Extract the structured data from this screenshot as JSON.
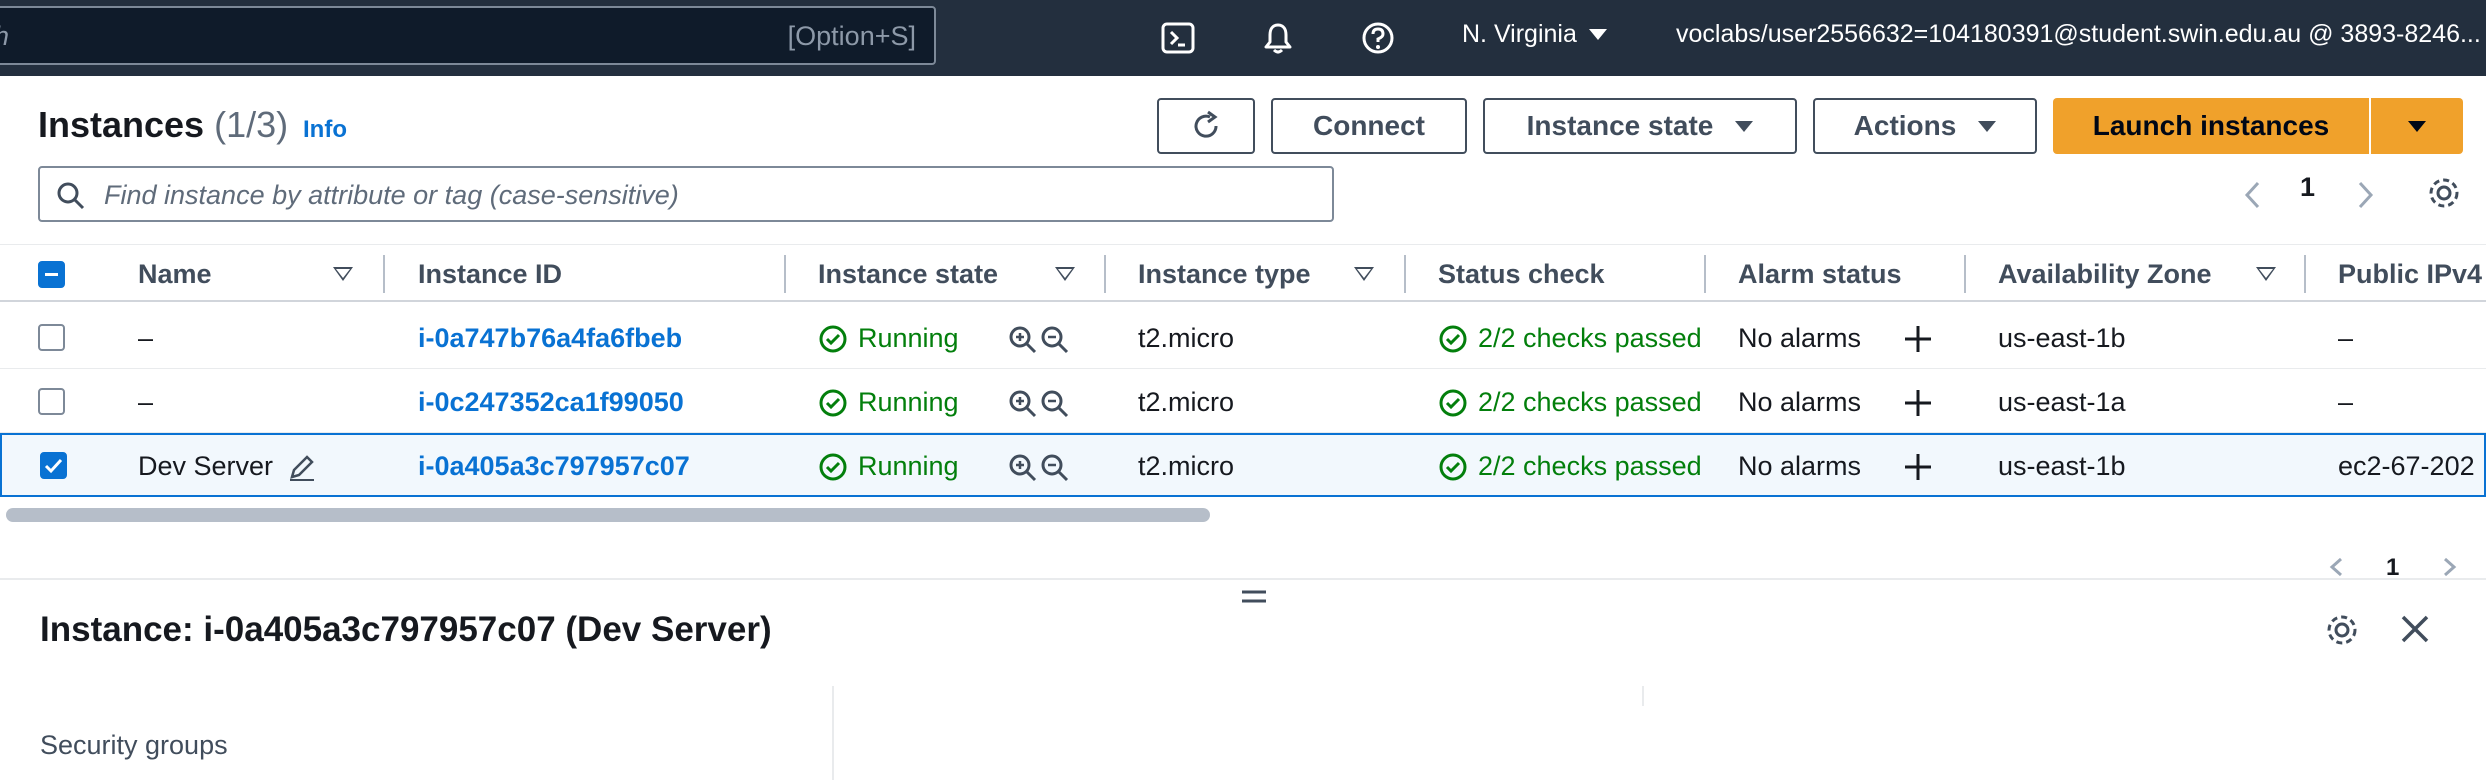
{
  "topbar": {
    "search_placeholder": "h",
    "search_shortcut": "[Option+S]",
    "region": "N. Virginia",
    "account": "voclabs/user2556632=104180391@student.swin.edu.au @ 3893-8246..."
  },
  "header": {
    "title": "Instances",
    "count": "(1/3)",
    "info": "Info",
    "buttons": {
      "connect": "Connect",
      "instance_state": "Instance state",
      "actions": "Actions",
      "launch": "Launch instances"
    }
  },
  "filter": {
    "placeholder": "Find instance by attribute or tag (case-sensitive)"
  },
  "pagination": {
    "page": "1",
    "bottom_page": "1"
  },
  "table": {
    "columns": [
      "Name",
      "Instance ID",
      "Instance state",
      "Instance type",
      "Status check",
      "Alarm status",
      "Availability Zone",
      "Public IPv4"
    ],
    "rows": [
      {
        "name": "–",
        "id": "i-0a747b76a4fa6fbeb",
        "state": "Running",
        "type": "t2.micro",
        "status": "2/2 checks passed",
        "alarm": "No alarms",
        "az": "us-east-1b",
        "ipv4": "–",
        "selected": false
      },
      {
        "name": "–",
        "id": "i-0c247352ca1f99050",
        "state": "Running",
        "type": "t2.micro",
        "status": "2/2 checks passed",
        "alarm": "No alarms",
        "az": "us-east-1a",
        "ipv4": "–",
        "selected": false
      },
      {
        "name": "Dev Server",
        "id": "i-0a405a3c797957c07",
        "state": "Running",
        "type": "t2.micro",
        "status": "2/2 checks passed",
        "alarm": "No alarms",
        "az": "us-east-1b",
        "ipv4": "ec2-67-202",
        "selected": true
      }
    ]
  },
  "details": {
    "title": "Instance: i-0a405a3c797957c07 (Dev Server)",
    "security_groups": "Security groups"
  },
  "colors": {
    "topbar": "#232f3e",
    "link": "#0972d3",
    "success": "#037f0c",
    "launch": "#f0a12b"
  }
}
